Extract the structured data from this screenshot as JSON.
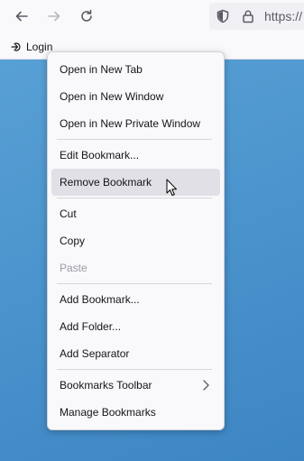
{
  "toolbar": {
    "url_text": "https://",
    "icons": [
      "back-arrow-icon",
      "forward-arrow-icon",
      "reload-icon",
      "shield-icon",
      "lock-icon"
    ]
  },
  "bookmarks_bar": {
    "item_label": "Login",
    "item_icon": "login-icon"
  },
  "context_menu": {
    "items": [
      {
        "label": "Open in New Tab"
      },
      {
        "label": "Open in New Window"
      },
      {
        "label": "Open in New Private Window"
      },
      {
        "label": "Edit Bookmark..."
      },
      {
        "label": "Remove Bookmark",
        "state": "hovered"
      },
      {
        "label": "Cut"
      },
      {
        "label": "Copy"
      },
      {
        "label": "Paste",
        "state": "disabled"
      },
      {
        "label": "Add Bookmark..."
      },
      {
        "label": "Add Folder..."
      },
      {
        "label": "Add Separator"
      },
      {
        "label": "Bookmarks Toolbar",
        "submenu": true
      },
      {
        "label": "Manage Bookmarks"
      }
    ]
  },
  "colors": {
    "desktop_blue": "#4f97cf",
    "menu_bg": "#f9f9fb",
    "hover_bg": "#e0e0e6",
    "disabled_text": "#9a9aa3"
  }
}
